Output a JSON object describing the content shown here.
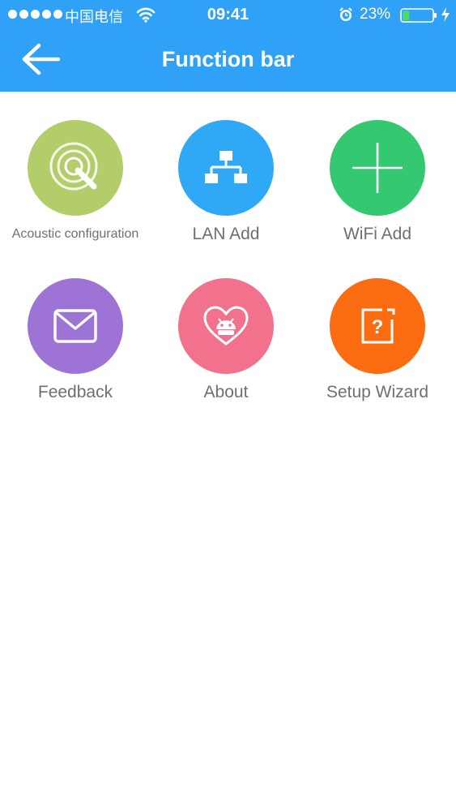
{
  "status_bar": {
    "carrier": "中国电信",
    "time": "09:41",
    "battery_percent": "23%",
    "battery_level": 0.23,
    "icons": [
      "signal-dots-icon",
      "wifi-icon",
      "alarm-icon",
      "battery-icon",
      "charging-bolt-icon"
    ]
  },
  "header": {
    "title": "Function bar",
    "back_icon": "arrow-left-icon"
  },
  "colors": {
    "header": "#2fa2f7",
    "acoustic": "#b2cd6a",
    "lan": "#2fa9f6",
    "wifi": "#34c871",
    "feedback": "#9d74d6",
    "about": "#f2718c",
    "wizard": "#fb6c10",
    "label": "#6f6f6f"
  },
  "functions": [
    {
      "label": "Acoustic configuration",
      "icon": "sound-wave-icon"
    },
    {
      "label": "LAN Add",
      "icon": "network-topology-icon"
    },
    {
      "label": "WiFi Add",
      "icon": "plus-icon"
    },
    {
      "label": "Feedback",
      "icon": "envelope-icon"
    },
    {
      "label": "About",
      "icon": "heart-android-icon"
    },
    {
      "label": "Setup Wizard",
      "icon": "help-question-icon"
    }
  ]
}
